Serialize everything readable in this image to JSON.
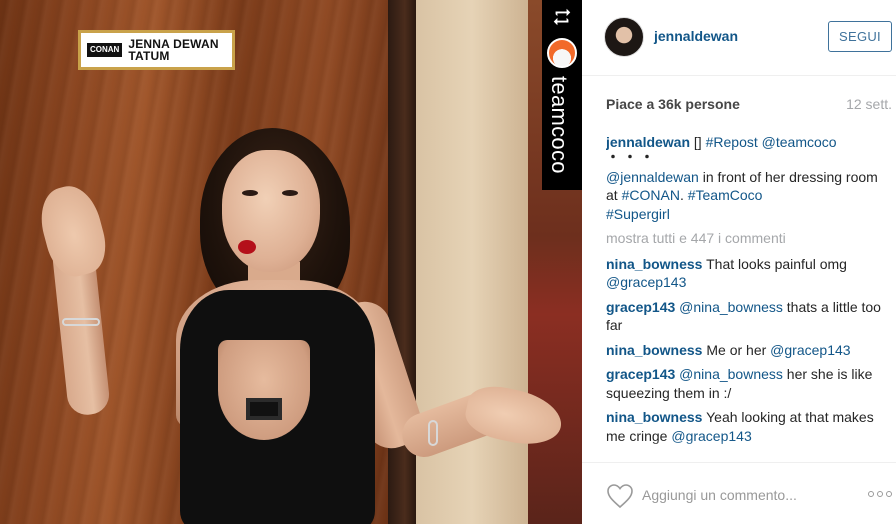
{
  "photo": {
    "nameplate": {
      "logo": "CONAN",
      "line1": "JENNA DEWAN",
      "line2": "TATUM"
    },
    "repost_badge": {
      "handle": "teamcoco"
    }
  },
  "post": {
    "author": "jennaldewan",
    "follow_label": "SEGUI",
    "likes": "Piace a 36k persone",
    "time": "12 sett.",
    "caption": {
      "user": "jennaldewan",
      "box": "[]",
      "repost_tag": "#Repost",
      "repost_user": "@teamcoco",
      "dots": "・・・",
      "mention": "@jennaldewan",
      "text1": " in front of her dressing room at ",
      "tag1": "#CONAN",
      "text2": ". ",
      "tag2": "#TeamCoco",
      "tag3": "#Supergirl"
    },
    "show_all": "mostra tutti e 447 i commenti",
    "comments": [
      {
        "user": "nina_bowness",
        "text": " That looks painful omg ",
        "mention": "@gracep143",
        "rest": ""
      },
      {
        "user": "gracep143",
        "text": " ",
        "mention": "@nina_bowness",
        "rest": " thats a little too far"
      },
      {
        "user": "nina_bowness",
        "text": " Me or her ",
        "mention": "@gracep143",
        "rest": ""
      },
      {
        "user": "gracep143",
        "text": " ",
        "mention": "@nina_bowness",
        "rest": " her she is like squeezing them in :/"
      },
      {
        "user": "nina_bowness",
        "text": " Yeah looking at that makes me cringe ",
        "mention": "@gracep143",
        "rest": ""
      }
    ],
    "add_comment_placeholder": "Aggiungi un commento..."
  }
}
